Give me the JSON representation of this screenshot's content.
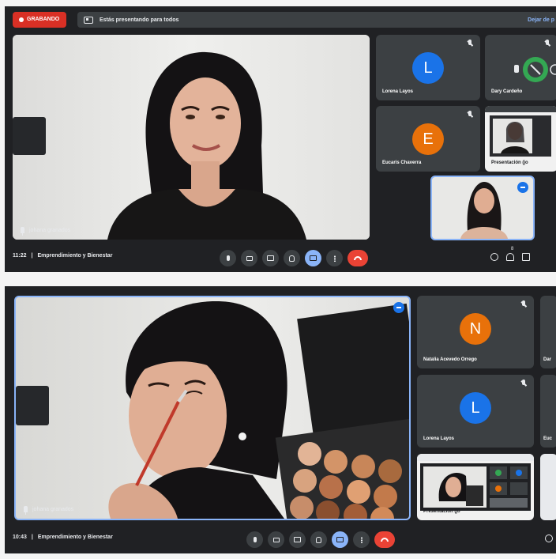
{
  "top_screenshot": {
    "recording_label": "GRABANDO",
    "presenting_text": "Estás presentando para todos",
    "stop_presenting_label": "Dejar de p",
    "main_participant_name": "johana granados",
    "tiles": [
      {
        "name": "Lorena Layos",
        "initial": "L",
        "color": "#1a73e8"
      },
      {
        "name": "Dary Cardeño"
      },
      {
        "name": "Eucaris Chaverra",
        "initial": "E",
        "color": "#e8710a"
      },
      {
        "name": "Presentación (johana granados)",
        "short_label": "Presentación (jo"
      }
    ],
    "time": "11:22",
    "separator": "|",
    "meeting_title": "Emprendimiento y Bienestar",
    "people_count": "8"
  },
  "bottom_screenshot": {
    "main_participant_name": "johana granados",
    "tiles": [
      {
        "name": "Natalia Acevedo Orrego",
        "initial": "N",
        "color": "#e8710a"
      },
      {
        "name": "Lorena Layos",
        "initial": "L",
        "color": "#1a73e8"
      },
      {
        "name": "Presentación (johana granados)",
        "short_label": "Presentación (jo"
      },
      {
        "name": "Dar"
      },
      {
        "name": "Euc"
      }
    ],
    "time": "10:43",
    "separator": "|",
    "meeting_title": "Emprendimiento y Bienestar"
  },
  "controls": [
    {
      "name": "microphone",
      "icon": "mic-icon"
    },
    {
      "name": "camera",
      "icon": "camera-icon"
    },
    {
      "name": "captions",
      "icon": "captions-icon"
    },
    {
      "name": "raise-hand",
      "icon": "hand-icon"
    },
    {
      "name": "present-now",
      "icon": "present-icon",
      "active": true
    },
    {
      "name": "more-options",
      "icon": "more-vert-icon"
    },
    {
      "name": "leave-call",
      "icon": "phone-hangup-icon"
    }
  ],
  "colors": {
    "background": "#202124",
    "tile": "#3c4043",
    "accent": "#8ab4f8",
    "record": "#d93025",
    "end_call": "#ea4335"
  }
}
